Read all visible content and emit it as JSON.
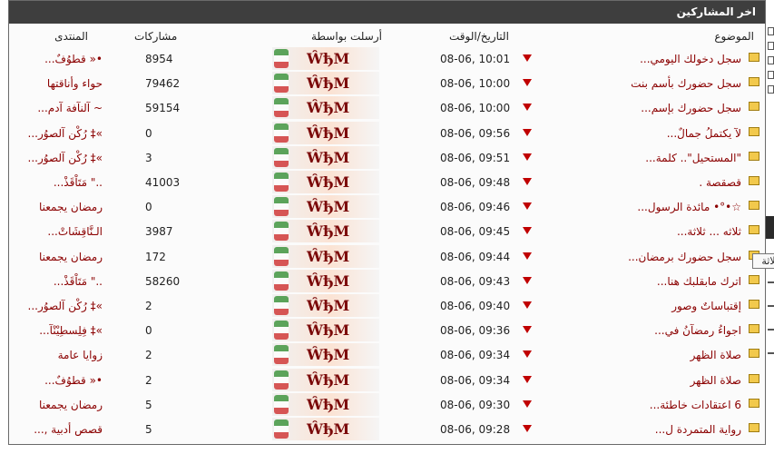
{
  "header": {
    "title": "اخر المشاركين"
  },
  "columns": {
    "topic": "الموضوع",
    "date": "التاريخ/الوقت",
    "sent_by": "أرسلت بواسطة",
    "posts": "مشاركات",
    "forum": "المنتدى"
  },
  "avatar_text": "ŴђM",
  "rows": [
    {
      "topic": "سجل دخولك اليومي...",
      "date": "08-06, 10:01",
      "posts": "8954",
      "forum": "•« قطوُفٌ..."
    },
    {
      "topic": "سجل حضورك بأسم بنت",
      "date": "08-06, 10:00",
      "posts": "79462",
      "forum": "حواء وأناقتها"
    },
    {
      "topic": "سجل حضورك بإسم...",
      "date": "08-06, 10:00",
      "posts": "59154",
      "forum": "~ آلنآفة آدم..."
    },
    {
      "topic": "لآ يكتملُ جمالٌ...",
      "date": "08-06, 09:56",
      "posts": "0",
      "forum": "»‡ رُكْن آلصوُر..."
    },
    {
      "topic": "\"المستحيل\".. كلمة...",
      "date": "08-06, 09:51",
      "posts": "3",
      "forum": "»‡ رُكْن آلصوُر..."
    },
    {
      "topic": "قصقصة .",
      "date": "08-06, 09:48",
      "posts": "41003",
      "forum": "..\" مَتَاْقَذْ..."
    },
    {
      "topic": "☆•°• مائدة الرسول...",
      "date": "08-06, 09:46",
      "posts": "0",
      "forum": "رمضان يجمعنا"
    },
    {
      "topic": "ثلاثه ... ثلاثة...",
      "date": "08-06, 09:45",
      "posts": "3987",
      "forum": "الـنَّاقِشَاتْ..."
    },
    {
      "topic": "سجل حضورك برمضان...",
      "date": "08-06, 09:44",
      "posts": "172",
      "forum": "رمضان يجمعنا"
    },
    {
      "topic": "اترك مابقلبك هنا...",
      "date": "08-06, 09:43",
      "posts": "58260",
      "forum": "..\" مَتَاْقَذْ..."
    },
    {
      "topic": "إقتباساتٌ وصور",
      "date": "08-06, 09:40",
      "posts": "2",
      "forum": "»‡ رُكْن آلصوُر..."
    },
    {
      "topic": "اجواءُ رمضآنُ في...",
      "date": "08-06, 09:36",
      "posts": "0",
      "forum": "»‡ فِلِسطِيْنْآ..."
    },
    {
      "topic": "صلاة الظهر",
      "date": "08-06, 09:34",
      "posts": "2",
      "forum": "زوايا عامة"
    },
    {
      "topic": "صلاة الظهر",
      "date": "08-06, 09:34",
      "posts": "2",
      "forum": "•« قطوُفٌ..."
    },
    {
      "topic": "6 اعتقادات خاطئة...",
      "date": "08-06, 09:30",
      "posts": "5",
      "forum": "رمضان يجمعنا"
    },
    {
      "topic": "رواية المتمردة ل...",
      "date": "08-06, 09:28",
      "posts": "5",
      "forum": "قصص أدبية ,..."
    }
  ],
  "tooltip": "ثلاثة"
}
